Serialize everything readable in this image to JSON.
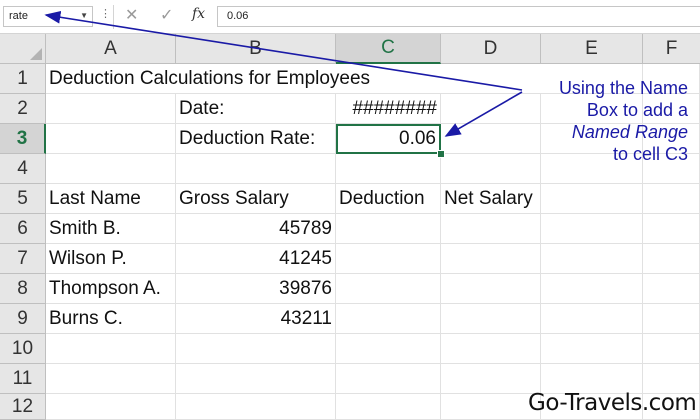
{
  "formula_bar": {
    "name_box_value": "rate",
    "more_icon": "vertical-ellipsis-icon",
    "cancel_icon": "x-icon",
    "enter_icon": "check-icon",
    "fx_label": "fx",
    "content": "0.06"
  },
  "columns": [
    "A",
    "B",
    "C",
    "D",
    "E",
    "F"
  ],
  "selected_column": "C",
  "rows": [
    "1",
    "2",
    "3",
    "4",
    "5",
    "6",
    "7",
    "8",
    "9",
    "10",
    "11",
    "12"
  ],
  "selected_row": "3",
  "cells": {
    "A1": "Deduction Calculations for Employees",
    "B2": "Date:",
    "C2": "########",
    "B3": "Deduction Rate:",
    "C3": "0.06",
    "A5": "Last Name",
    "B5": "Gross Salary",
    "C5": "Deduction",
    "D5": "Net Salary",
    "A6": "Smith B.",
    "B6": "45789",
    "A7": "Wilson P.",
    "B7": "41245",
    "A8": "Thompson A.",
    "B8": "39876",
    "A9": "Burns C.",
    "B9": "43211"
  },
  "annotation": {
    "line1": "Using the Name",
    "line2": "Box to add a",
    "line3": "Named Range",
    "line4": "to cell C3"
  },
  "colors": {
    "accent": "#217346",
    "annotation": "#1a1aa6"
  },
  "watermark": "Go-Travels.com"
}
